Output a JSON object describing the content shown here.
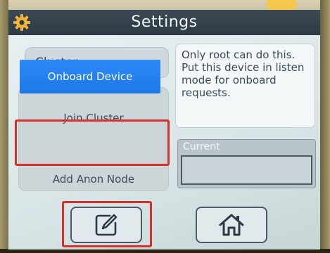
{
  "header": {
    "title": "Settings",
    "icon": "gear-icon"
  },
  "mode_select": {
    "value": "Cluster",
    "icon": "chevron-down-icon"
  },
  "info": {
    "text": "Only root can do this. Put this device in listen mode for onboard requests."
  },
  "menu": {
    "items": [
      {
        "label": "Join Cluster",
        "selected": false
      },
      {
        "label": "Onboard Device",
        "selected": true
      },
      {
        "label": "Add Anon Node",
        "selected": false
      }
    ]
  },
  "current": {
    "label": "Current",
    "value": ""
  },
  "toolbar": {
    "edit_icon": "edit-icon",
    "home_icon": "home-icon"
  },
  "colors": {
    "accent": "#1f78e8",
    "highlight": "#d3312a",
    "titlebar": "#2d3a44"
  }
}
